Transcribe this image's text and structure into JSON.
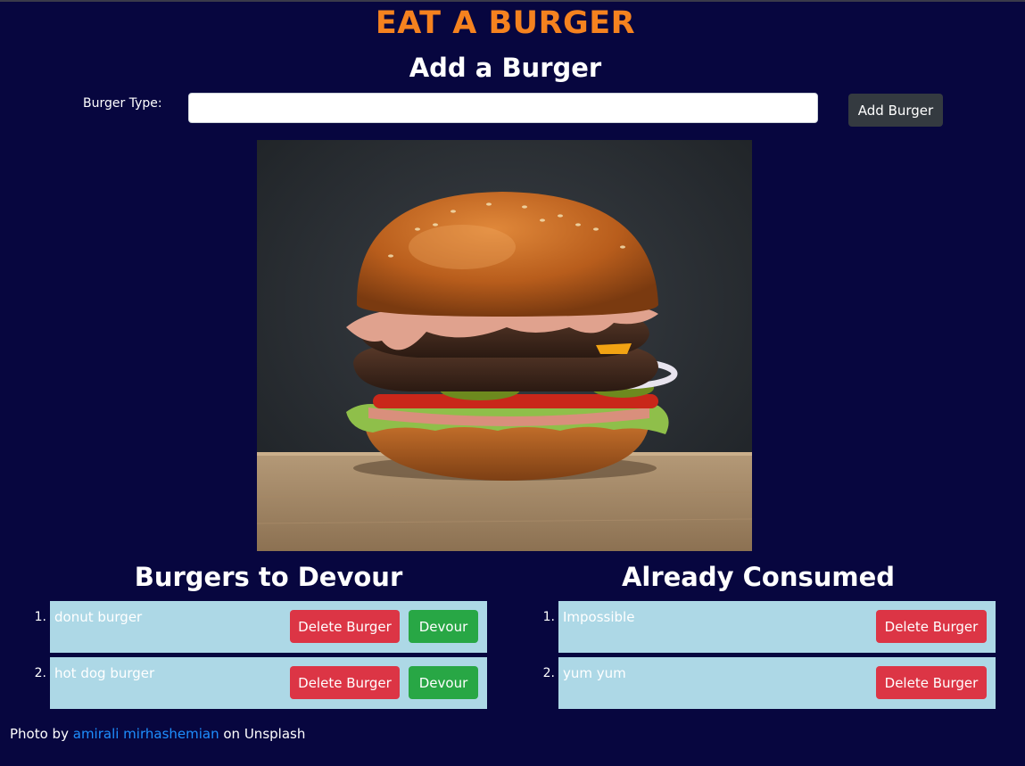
{
  "app": {
    "title": "EAT A BURGER"
  },
  "form": {
    "heading": "Add a Burger",
    "label": "Burger Type:",
    "value": "",
    "placeholder": "",
    "button_label": "Add Burger"
  },
  "image": {
    "subject": "burger photo"
  },
  "devour": {
    "heading": "Burgers to Devour",
    "items": [
      {
        "number": "1.",
        "name": "donut burger",
        "delete_label": "Delete Burger",
        "devour_label": "Devour"
      },
      {
        "number": "2.",
        "name": "hot dog burger",
        "delete_label": "Delete Burger",
        "devour_label": "Devour"
      }
    ]
  },
  "consumed": {
    "heading": "Already Consumed",
    "items": [
      {
        "number": "1.",
        "name": "Impossible",
        "delete_label": "Delete Burger"
      },
      {
        "number": "2.",
        "name": "yum yum",
        "delete_label": "Delete Burger"
      }
    ]
  },
  "credit": {
    "prefix": "Photo by",
    "author": "amirali mirhashemian",
    "suffix": "on Unsplash"
  },
  "colors": {
    "background": "#07063f",
    "title": "#f5821f",
    "item_bg": "#add8e6",
    "delete": "#dc3545",
    "devour": "#28a745",
    "add_button": "#343a40",
    "link": "#1e8fff"
  }
}
